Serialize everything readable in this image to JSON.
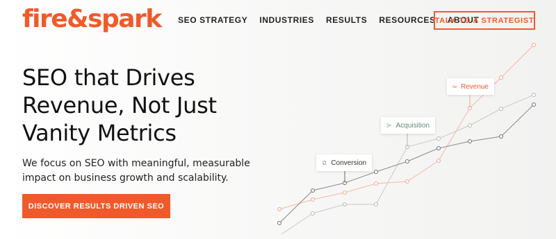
{
  "brand": {
    "logo_text": "fire&spark",
    "accent": "#f05a2b"
  },
  "nav": {
    "items": [
      {
        "label": "SEO STRATEGY"
      },
      {
        "label": "INDUSTRIES"
      },
      {
        "label": "RESULTS"
      },
      {
        "label": "RESOURCES"
      },
      {
        "label": "ABOUT"
      }
    ],
    "cta_label": "TALK TO A STRATEGIST"
  },
  "hero": {
    "title_lines": [
      "SEO that Drives",
      "Revenue, Not Just",
      "Vanity Metrics"
    ],
    "description": "We focus on SEO with meaningful, measurable impact on business growth and scalability.",
    "cta_label": "DISCOVER RESULTS DRIVEN SEO"
  },
  "graph_tags": {
    "revenue": {
      "label": "Revenue",
      "icon": "revenue-icon",
      "color": "#f05a2b"
    },
    "acquisition": {
      "label": "Acquisition",
      "icon": "acquisition-icon",
      "color": "#5a8a78"
    },
    "conversion": {
      "label": "Conversion",
      "icon": "conversion-icon",
      "color": "#333333"
    }
  }
}
